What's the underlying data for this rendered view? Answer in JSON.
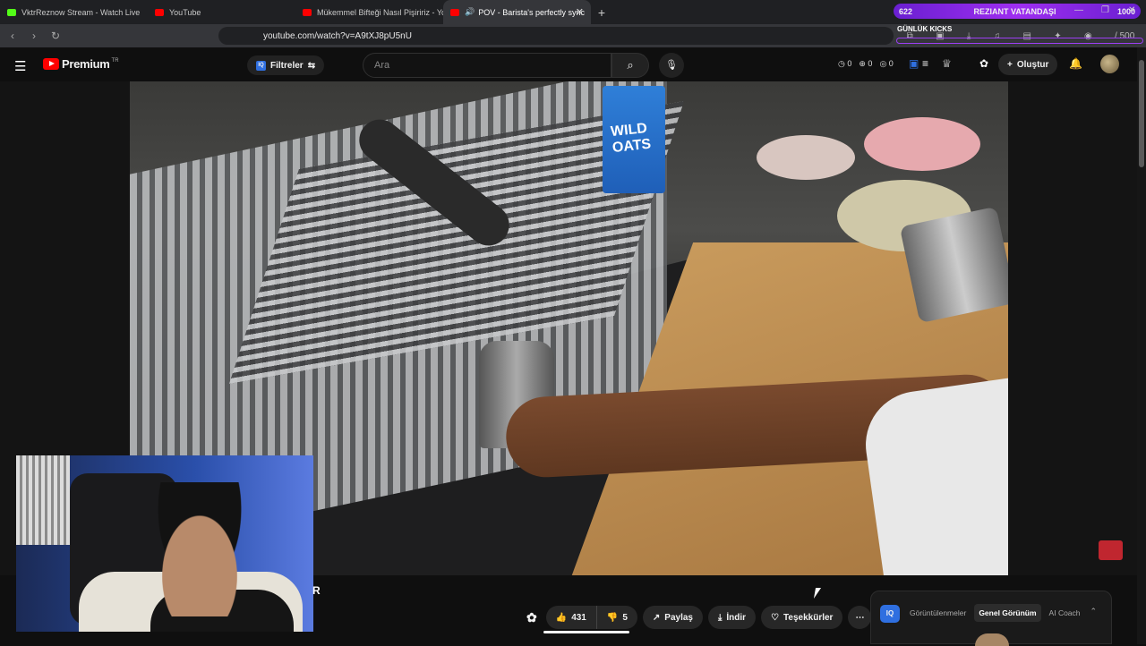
{
  "browser": {
    "tabs": [
      {
        "title": "VktrReznow Stream - Watch Live",
        "color": "#53fc18"
      },
      {
        "title": "YouTube",
        "color": "#ff0000"
      },
      {
        "title": "Mükemmel Bifteği Nasıl Pişiririz - You",
        "color": "#ff0000"
      },
      {
        "title": "POV - Barista's perfectly sync",
        "color": "#ff0000",
        "active": true
      }
    ],
    "new_tab": "+",
    "url": "youtube.com/watch?v=A9tXJ8pU5nU"
  },
  "kick_overlay": {
    "left_count": "622",
    "title": "REZIANT VATANDAŞI",
    "right_count": "1000",
    "daily_label": "GÜNLÜK KICKS",
    "daily_value": "/ 500"
  },
  "youtube": {
    "logo_text": "Premium",
    "country_code": "TR",
    "filters_label": "Filtreler",
    "search_placeholder": "Ara",
    "counters": [
      "0",
      "0",
      "0"
    ],
    "create_label": "Oluştur"
  },
  "video": {
    "milk_brand": "WILD OATS",
    "overlay_letter": "R"
  },
  "actions": {
    "likes": "431",
    "dislikes": "5",
    "share": "Paylaş",
    "download": "İndir",
    "thanks": "Teşekkürler",
    "more": "⋯"
  },
  "side_panel": {
    "logo": "IQ",
    "tabs": [
      "Görüntülenmeler",
      "Genel Görünüm",
      "AI Coach"
    ],
    "active_tab": 1
  },
  "colors": {
    "kick_purple": "#9e2ef0",
    "youtube_red": "#ff0000",
    "iq_blue": "#2f6fe0"
  }
}
